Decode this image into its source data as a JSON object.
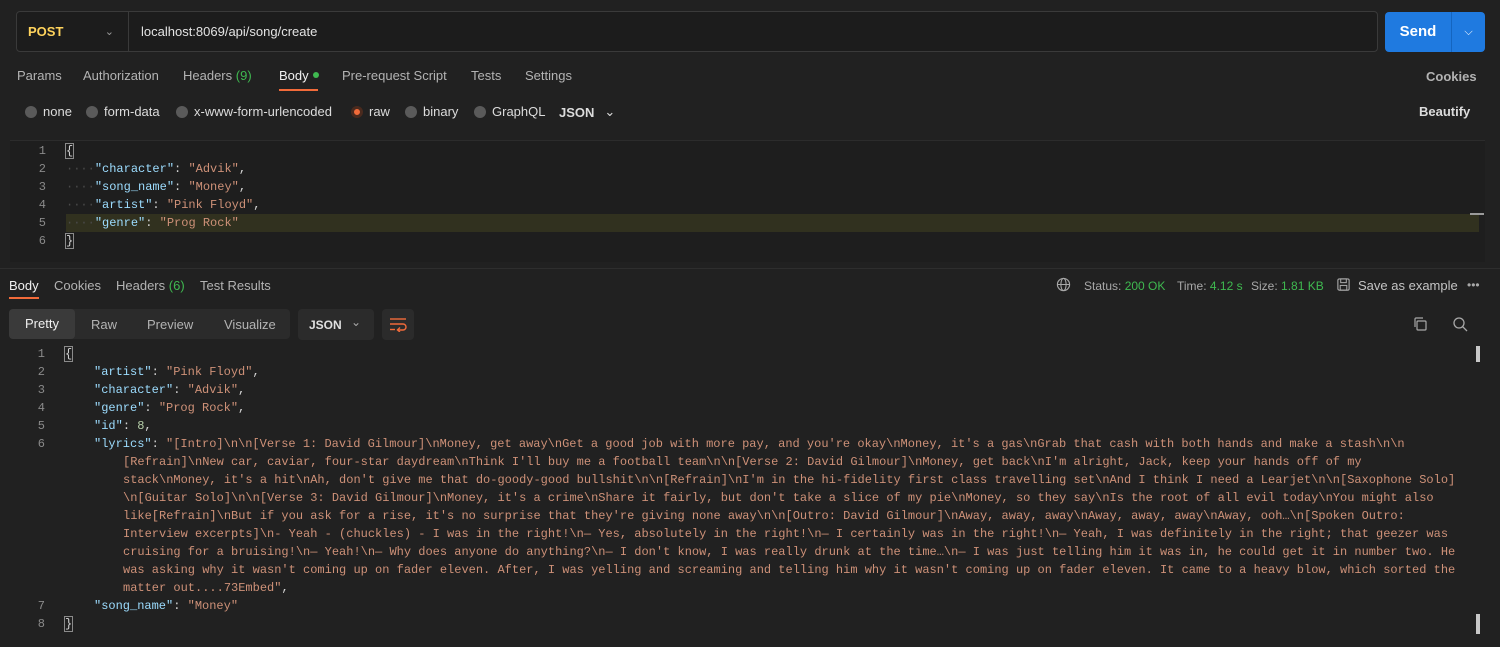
{
  "request": {
    "method": "POST",
    "url": "localhost:8069/api/song/create",
    "send_label": "Send"
  },
  "request_tabs": {
    "params": "Params",
    "authorization": "Authorization",
    "headers": "Headers",
    "headers_count": "(9)",
    "body": "Body",
    "pre_request": "Pre-request Script",
    "tests": "Tests",
    "settings": "Settings",
    "cookies": "Cookies"
  },
  "body_types": {
    "none": "none",
    "form_data": "form-data",
    "urlencoded": "x-www-form-urlencoded",
    "raw": "raw",
    "binary": "binary",
    "graphql": "GraphQL",
    "json": "JSON",
    "beautify": "Beautify"
  },
  "request_body": {
    "line_numbers": [
      "1",
      "2",
      "3",
      "4",
      "5",
      "6"
    ],
    "open": "{",
    "close": "}",
    "fields": [
      {
        "key": "\"character\"",
        "value": "\"Advik\"",
        "sep": ","
      },
      {
        "key": "\"song_name\"",
        "value": "\"Money\"",
        "sep": ","
      },
      {
        "key": "\"artist\"",
        "value": "\"Pink Floyd\"",
        "sep": ","
      },
      {
        "key": "\"genre\"",
        "value": "\"Prog Rock\"",
        "sep": ""
      }
    ]
  },
  "response_tabs": {
    "body": "Body",
    "cookies": "Cookies",
    "headers": "Headers",
    "headers_count": "(6)",
    "test_results": "Test Results"
  },
  "response_meta": {
    "status_label": "Status:",
    "status_value": "200 OK",
    "time_label": "Time:",
    "time_value": "4.12 s",
    "size_label": "Size:",
    "size_value": "1.81 KB",
    "save_example": "Save as example",
    "more": "•••"
  },
  "view_modes": {
    "pretty": "Pretty",
    "raw": "Raw",
    "preview": "Preview",
    "visualize": "Visualize",
    "format": "JSON"
  },
  "response_body": {
    "line_numbers": [
      "1",
      "2",
      "3",
      "4",
      "5",
      "6",
      "7",
      "8"
    ],
    "open": "{",
    "close": "}",
    "artist": {
      "key": "\"artist\"",
      "value": "\"Pink Floyd\""
    },
    "character": {
      "key": "\"character\"",
      "value": "\"Advik\""
    },
    "genre": {
      "key": "\"genre\"",
      "value": "\"Prog Rock\""
    },
    "id": {
      "key": "\"id\"",
      "value": "8"
    },
    "lyrics_key": "\"lyrics\"",
    "lyrics_lines": [
      "\"[Intro]\\n\\n[Verse 1: David Gilmour]\\nMoney, get away\\nGet a good job with more pay, and you're okay\\nMoney, it's a gas\\nGrab that cash with both hands and make a stash\\n\\n",
      "[Refrain]\\nNew car, caviar, four-star daydream\\nThink I'll buy me a football team\\n\\n[Verse 2: David Gilmour]\\nMoney, get back\\nI'm alright, Jack, keep your hands off of my",
      "stack\\nMoney, it's a hit\\nAh, don't give me that do-goody-good bullshit\\n\\n[Refrain]\\nI'm in the hi-fidelity first class travelling set\\nAnd I think I need a Learjet\\n\\n[Saxophone Solo]",
      "\\n[Guitar Solo]\\n\\n[Verse 3: David Gilmour]\\nMoney, it's a crime\\nShare it fairly, but don't take a slice of my pie\\nMoney, so they say\\nIs the root of all evil today\\nYou might also",
      "like[Refrain]\\nBut if you ask for a rise, it's no surprise that they're giving none away\\n\\n[Outro: David Gilmour]\\nAway, away, away\\nAway, away, away\\nAway, ooh…\\n[Spoken Outro:",
      "Interview excerpts]\\n- Yeah - (chuckles) - I was in the right!\\n— Yes, absolutely in the right!\\n— I certainly was in the right!\\n— Yeah, I was definitely in the right; that geezer was",
      "cruising for a bruising!\\n— Yeah!\\n— Why does anyone do anything?\\n— I don't know, I was really drunk at the time…\\n— I was just telling him it was in, he could get it in number two. He",
      "was asking why it wasn't coming up on fader eleven. After, I was yelling and screaming and telling him why it wasn't coming up on fader eleven. It came to a heavy blow, which sorted the",
      "matter out....73Embed\""
    ],
    "song_name": {
      "key": "\"song_name\"",
      "value": "\"Money\""
    }
  },
  "colors": {
    "accent": "#f26b3a",
    "send": "#1f7ae0",
    "method": "#ffd35c",
    "status_ok": "#3fb950",
    "link": "#4a9ff5"
  }
}
